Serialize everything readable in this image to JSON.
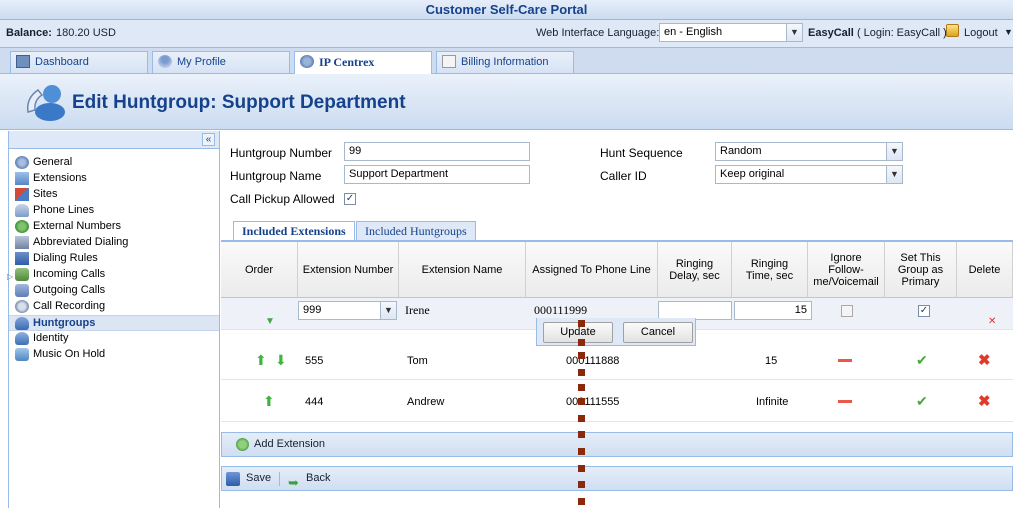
{
  "portal_title": "Customer Self-Care Portal",
  "balance": {
    "label": "Balance:",
    "value": "180.20 USD"
  },
  "language": {
    "label": "Web Interface Language:",
    "value": "en - English"
  },
  "user": {
    "name": "EasyCall",
    "login_text": "( Login: EasyCall )",
    "logout_label": "Logout"
  },
  "tabs": [
    {
      "label": "Dashboard"
    },
    {
      "label": "My Profile"
    },
    {
      "label": "IP Centrex"
    },
    {
      "label": "Billing Information"
    }
  ],
  "page_title": "Edit Huntgroup: Support Department",
  "sidebar": {
    "collapse_label": "«",
    "items": [
      {
        "label": "General"
      },
      {
        "label": "Extensions"
      },
      {
        "label": "Sites"
      },
      {
        "label": "Phone Lines"
      },
      {
        "label": "External Numbers"
      },
      {
        "label": "Abbreviated Dialing"
      },
      {
        "label": "Dialing Rules"
      },
      {
        "label": "Incoming Calls"
      },
      {
        "label": "Outgoing Calls"
      },
      {
        "label": "Call Recording"
      },
      {
        "label": "Huntgroups"
      },
      {
        "label": "Identity"
      },
      {
        "label": "Music On Hold"
      }
    ]
  },
  "form": {
    "number_label": "Huntgroup Number",
    "number_value": "99",
    "name_label": "Huntgroup Name",
    "name_value": "Support Department",
    "pickup_label": "Call Pickup Allowed",
    "pickup_checked": "✓",
    "sequence_label": "Hunt Sequence",
    "sequence_value": "Random",
    "callerid_label": "Caller ID",
    "callerid_value": "Keep original"
  },
  "subtabs": [
    {
      "label": "Included Extensions"
    },
    {
      "label": "Included Huntgroups"
    }
  ],
  "grid": {
    "headers": {
      "order": "Order",
      "ext_number": "Extension Number",
      "ext_name": "Extension Name",
      "assigned": "Assigned To Phone Line",
      "delay": "Ringing Delay, sec",
      "time": "Ringing Time, sec",
      "ignore": "Ignore Follow-me/Voicemail",
      "primary": "Set This Group as Primary",
      "delete": "Delete"
    },
    "edit_row": {
      "ext_number": "999",
      "ext_name": "Irene",
      "assigned": "000111999",
      "delay": "",
      "time": "15",
      "primary_checked": "✓"
    },
    "update_label": "Update",
    "cancel_label": "Cancel",
    "rows": [
      {
        "ext_number": "555",
        "ext_name": "Tom",
        "assigned": "000111888",
        "time": "15"
      },
      {
        "ext_number": "444",
        "ext_name": "Andrew",
        "assigned": "000111555",
        "time": "Infinite"
      }
    ]
  },
  "add_extension_label": "Add Extension",
  "save_label": "Save",
  "back_label": "Back"
}
